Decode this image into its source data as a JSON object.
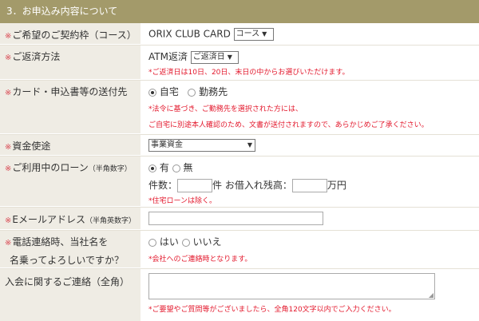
{
  "section_title": "3．お申込み内容について",
  "rows": {
    "contract": {
      "label": "ご希望のご契約枠（コース）",
      "product": "ORIX CLUB CARD",
      "select": "コース"
    },
    "repay": {
      "label": "ご返済方法",
      "method": "ATM返済",
      "select": "ご返済日",
      "note": "*ご返済日は10日、20日、末日の中からお選びいただけます。"
    },
    "mail": {
      "label": "カード・申込書等の送付先",
      "opt1": "自宅",
      "opt2": "勤務先",
      "note1": "*法令に基づき、ご勤務先を選択された方には、",
      "note2": "ご自宅に別途本人確認のため、文書が送付されますので、あらかじめご了承ください。"
    },
    "purpose": {
      "label": "資金使途",
      "select": "事業資金"
    },
    "loans": {
      "label": "ご利用中のローン",
      "label_small": "（半角数字）",
      "opt1": "有",
      "opt2": "無",
      "count_label": "件数：",
      "count_unit": "件",
      "balance_label": "お借入れ残高：",
      "balance_unit": "万円",
      "note": "*住宅ローンは除く。"
    },
    "email": {
      "label": "Eメールアドレス",
      "label_small": "（半角英数字）"
    },
    "phone": {
      "label1": "電話連絡時、当社名を",
      "label2": "名乗ってよろしいですか？",
      "opt1": "はい",
      "opt2": "いいえ",
      "note": "*会社へのご連絡時となります。"
    },
    "contact": {
      "label": "入会に関するご連絡（全角）",
      "note": "*ご要望やご質問等がございましたら、全角120文字以内でご入力ください。"
    }
  },
  "required_mark": "※"
}
